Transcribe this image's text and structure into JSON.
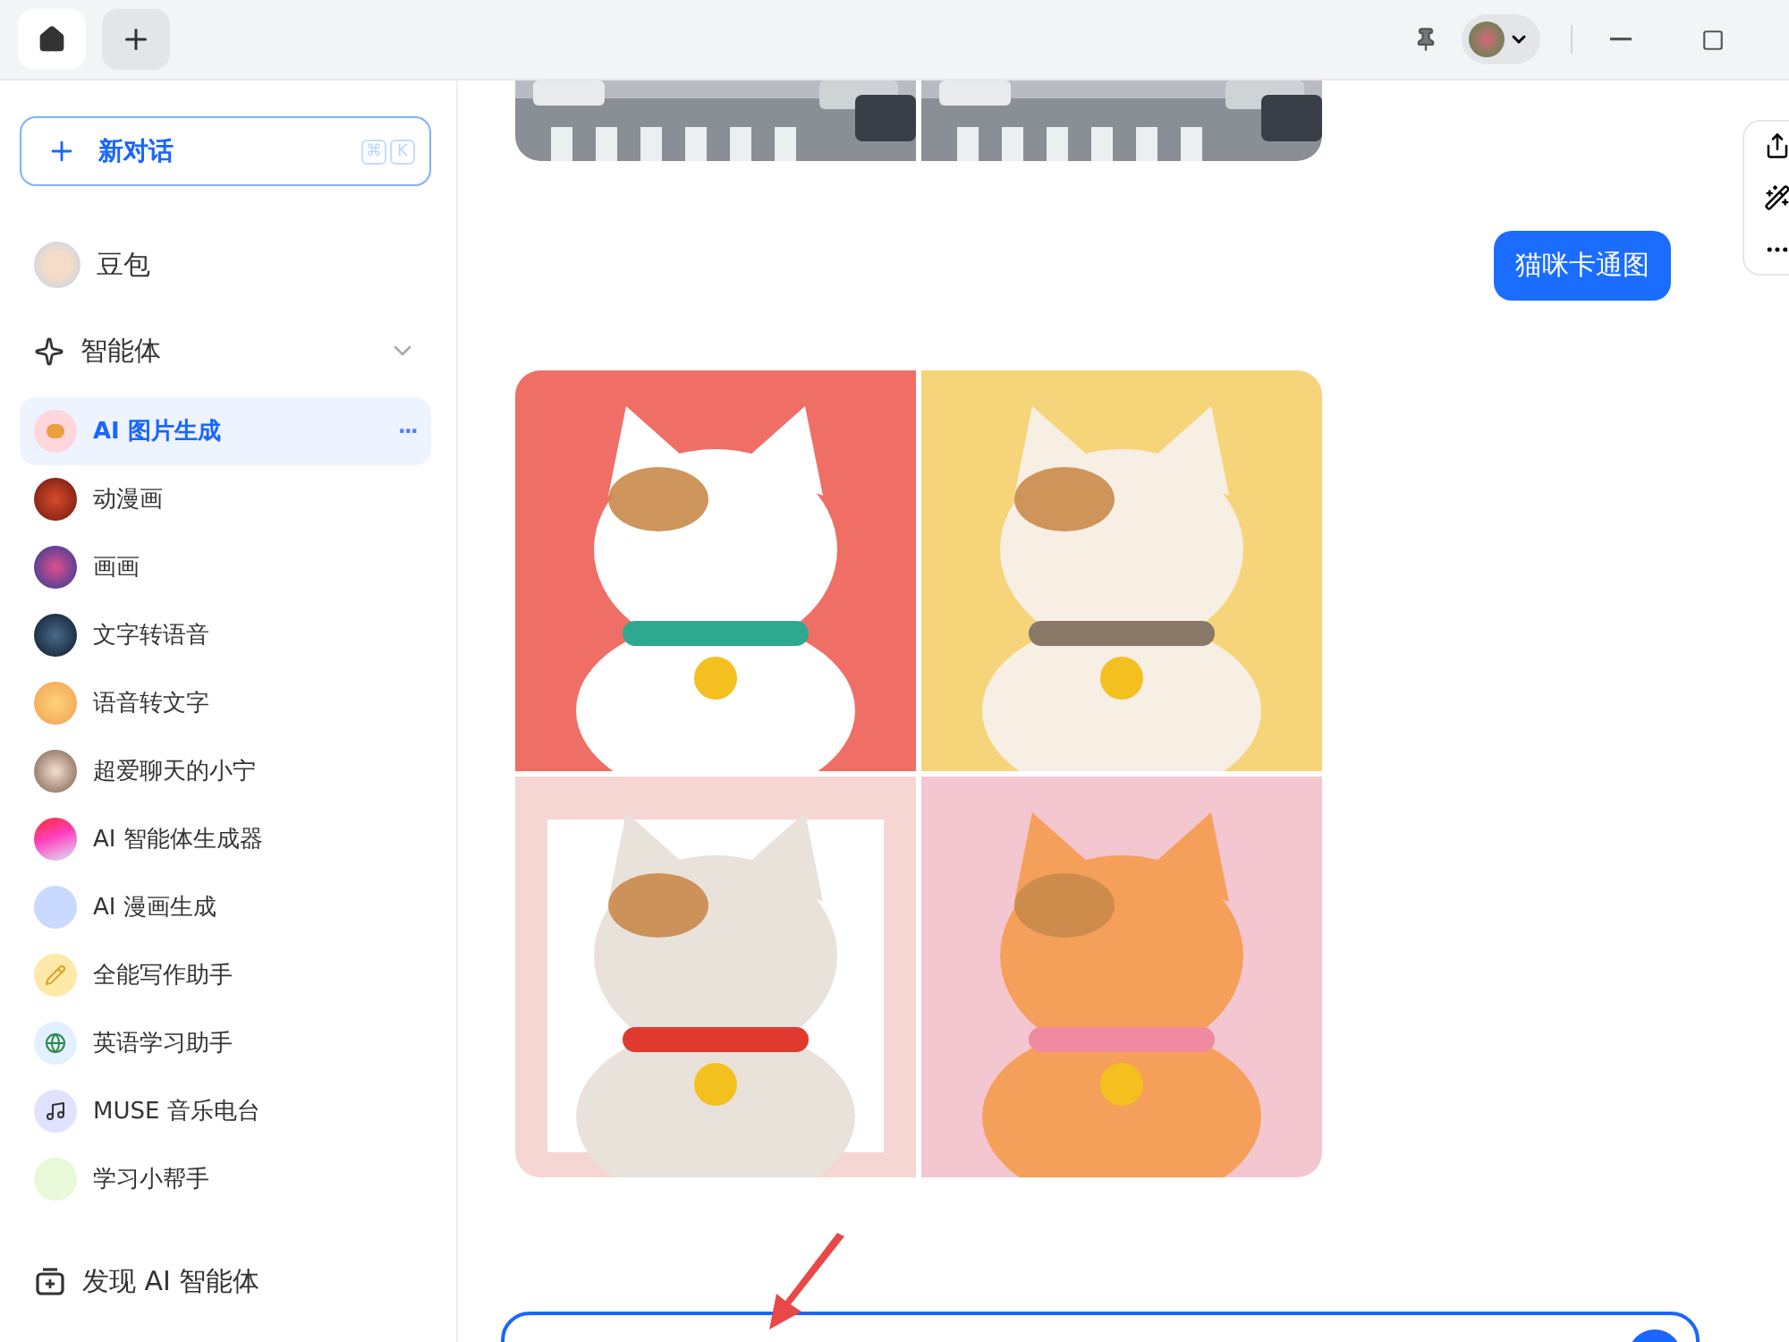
{
  "new_chat": {
    "label": "新对话",
    "keys": [
      "⌘",
      "K"
    ]
  },
  "sidebar": {
    "main": {
      "label": "豆包"
    },
    "section": {
      "label": "智能体",
      "expanded": true,
      "items": [
        {
          "label": "AI 图片生成",
          "selected": true,
          "more": "···"
        },
        {
          "label": "动漫画",
          "selected": false
        },
        {
          "label": "画画",
          "selected": false
        },
        {
          "label": "文字转语音",
          "selected": false
        },
        {
          "label": "语音转文字",
          "selected": false
        },
        {
          "label": "超爱聊天的小宁",
          "selected": false
        },
        {
          "label": "AI 智能体生成器",
          "selected": false
        },
        {
          "label": "AI 漫画生成",
          "selected": false
        },
        {
          "label": "全能写作助手",
          "selected": false
        },
        {
          "label": "英语学习助手",
          "selected": false
        },
        {
          "label": "MUSE 音乐电台",
          "selected": false
        },
        {
          "label": "学习小帮手",
          "selected": false
        }
      ]
    },
    "discover": {
      "label": "发现 AI 智能体"
    }
  },
  "chat": [
    {
      "kind": "photos"
    },
    {
      "kind": "user",
      "text": "猫咪卡通图"
    },
    {
      "kind": "drawings"
    }
  ]
}
